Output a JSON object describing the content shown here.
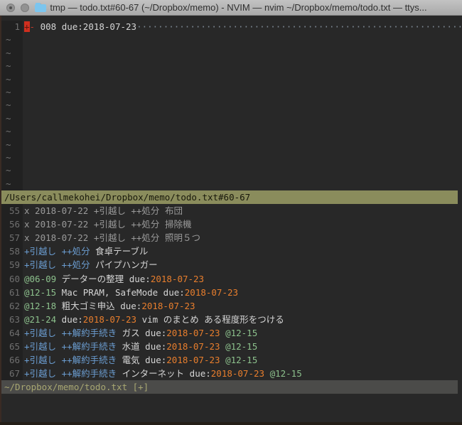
{
  "window": {
    "title": "tmp — todo.txt#60-67 (~/Dropbox/memo) - NVIM — nvim ~/Dropbox/memo/todo.txt — ttys..."
  },
  "colors": {
    "background": "#282828",
    "accent_blue": "#6b9dd1",
    "accent_green": "#8cc08c",
    "accent_orange": "#e87e2d",
    "cursor_red": "#cf2f1f",
    "statusline_active_bg": "#8a8c5c",
    "statusline_inactive_bg": "#4b4b49"
  },
  "editor_top": {
    "line_number": "1",
    "cursor_char": "+",
    "after_cursor_text": "-",
    "line_text": " 008 due:2018-07-23",
    "trailing_dots": "···········································································",
    "tilde_char": "~",
    "tilde_count": 12
  },
  "statusline_top": {
    "text": "/Users/callmekohei/Dropbox/memo/todo.txt#60-67"
  },
  "buffer_lines": [
    {
      "num": "55",
      "segments": [
        {
          "c": "done",
          "t": "x 2018-07-22 +引越し ++処分 布団"
        }
      ]
    },
    {
      "num": "56",
      "segments": [
        {
          "c": "done",
          "t": "x 2018-07-22 +引越し ++処分 掃除機"
        }
      ]
    },
    {
      "num": "57",
      "segments": [
        {
          "c": "done",
          "t": "x 2018-07-22 +引越し ++処分 照明５つ"
        }
      ]
    },
    {
      "num": "58",
      "segments": [
        {
          "c": "tag",
          "t": "+引越し"
        },
        {
          "c": "plain",
          "t": " "
        },
        {
          "c": "tag",
          "t": "++処分"
        },
        {
          "c": "plain",
          "t": " 食卓テーブル"
        }
      ]
    },
    {
      "num": "59",
      "segments": [
        {
          "c": "tag",
          "t": "+引越し"
        },
        {
          "c": "plain",
          "t": " "
        },
        {
          "c": "tag",
          "t": "++処分"
        },
        {
          "c": "plain",
          "t": " パイプハンガー"
        }
      ]
    },
    {
      "num": "60",
      "segments": [
        {
          "c": "ctx",
          "t": "@06-09"
        },
        {
          "c": "plain",
          "t": " データーの整理 due:"
        },
        {
          "c": "date",
          "t": "2018-07-23"
        }
      ]
    },
    {
      "num": "61",
      "segments": [
        {
          "c": "ctx",
          "t": "@12-15"
        },
        {
          "c": "plain",
          "t": " Mac PRAM, SafeMode due:"
        },
        {
          "c": "date",
          "t": "2018-07-23"
        }
      ]
    },
    {
      "num": "62",
      "segments": [
        {
          "c": "ctx",
          "t": "@12-18"
        },
        {
          "c": "plain",
          "t": " 粗大ゴミ申込 due:"
        },
        {
          "c": "date",
          "t": "2018-07-23"
        }
      ]
    },
    {
      "num": "63",
      "segments": [
        {
          "c": "ctx",
          "t": "@21-24"
        },
        {
          "c": "plain",
          "t": " due:"
        },
        {
          "c": "date",
          "t": "2018-07-23"
        },
        {
          "c": "plain",
          "t": " vim のまとめ ある程度形をつける"
        }
      ]
    },
    {
      "num": "64",
      "segments": [
        {
          "c": "tag",
          "t": "+引越し"
        },
        {
          "c": "plain",
          "t": " "
        },
        {
          "c": "tag",
          "t": "++解約手続き"
        },
        {
          "c": "plain",
          "t": " ガス due:"
        },
        {
          "c": "date",
          "t": "2018-07-23"
        },
        {
          "c": "plain",
          "t": " "
        },
        {
          "c": "ctx",
          "t": "@12-15"
        }
      ]
    },
    {
      "num": "65",
      "segments": [
        {
          "c": "tag",
          "t": "+引越し"
        },
        {
          "c": "plain",
          "t": " "
        },
        {
          "c": "tag",
          "t": "++解約手続き"
        },
        {
          "c": "plain",
          "t": " 水道 due:"
        },
        {
          "c": "date",
          "t": "2018-07-23"
        },
        {
          "c": "plain",
          "t": " "
        },
        {
          "c": "ctx",
          "t": "@12-15"
        }
      ]
    },
    {
      "num": "66",
      "segments": [
        {
          "c": "tag",
          "t": "+引越し"
        },
        {
          "c": "plain",
          "t": " "
        },
        {
          "c": "tag",
          "t": "++解約手続き"
        },
        {
          "c": "plain",
          "t": " 電気 due:"
        },
        {
          "c": "date",
          "t": "2018-07-23"
        },
        {
          "c": "plain",
          "t": " "
        },
        {
          "c": "ctx",
          "t": "@12-15"
        }
      ]
    },
    {
      "num": "67",
      "segments": [
        {
          "c": "tag",
          "t": "+引越し"
        },
        {
          "c": "plain",
          "t": " "
        },
        {
          "c": "tag",
          "t": "++解約手続き"
        },
        {
          "c": "plain",
          "t": " インターネット due:"
        },
        {
          "c": "date",
          "t": "2018-07-23"
        },
        {
          "c": "plain",
          "t": " "
        },
        {
          "c": "ctx",
          "t": "@12-15"
        }
      ]
    }
  ],
  "statusline_bottom": {
    "text": "~/Dropbox/memo/todo.txt [+]"
  }
}
